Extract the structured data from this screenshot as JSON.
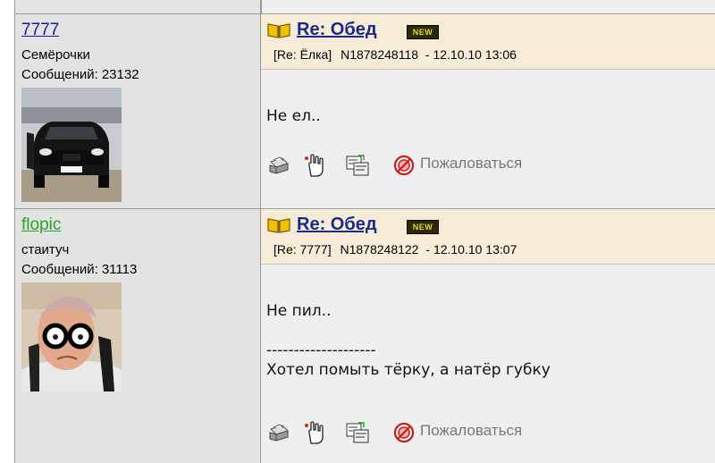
{
  "posts": [
    {
      "username": "7777",
      "username_color": "#1a1aa6",
      "status": "Семёрочки",
      "posts_label": "Сообщений:",
      "posts_count": "23132",
      "avatar_icon": "black-car-photo",
      "title": "Re: Обед",
      "new_badge": "NEW",
      "reply_to": "[Re: Ёлка]",
      "number": "N1878248118",
      "dash": "-",
      "date": "12.10.10 13:06",
      "body": "Не ел..",
      "complain_label": "Пожаловаться"
    },
    {
      "username": "flopic",
      "username_color": "#2aa32a",
      "status": "стаитуч",
      "posts_label": "Сообщений:",
      "posts_count": "31113",
      "avatar_icon": "man-with-glasses-photo",
      "title": "Re: Обед",
      "new_badge": "NEW",
      "reply_to": "[Re: 7777]",
      "number": "N1878248122",
      "dash": "-",
      "date": "12.10.10 13:07",
      "body": "Не пил..\n\n--------------------\nХотел помыть тёрку, а натёр губку",
      "complain_label": "Пожаловаться"
    }
  ],
  "icons": {
    "print": "print-icon",
    "quote": "quote-icon",
    "reply": "reply-icon",
    "complain": "complain-icon"
  },
  "colors": {
    "title": "#1a2a8c",
    "header_bg": "#f6ecd8",
    "user_bg": "#e3e3e3",
    "body_bg": "#efefef"
  }
}
